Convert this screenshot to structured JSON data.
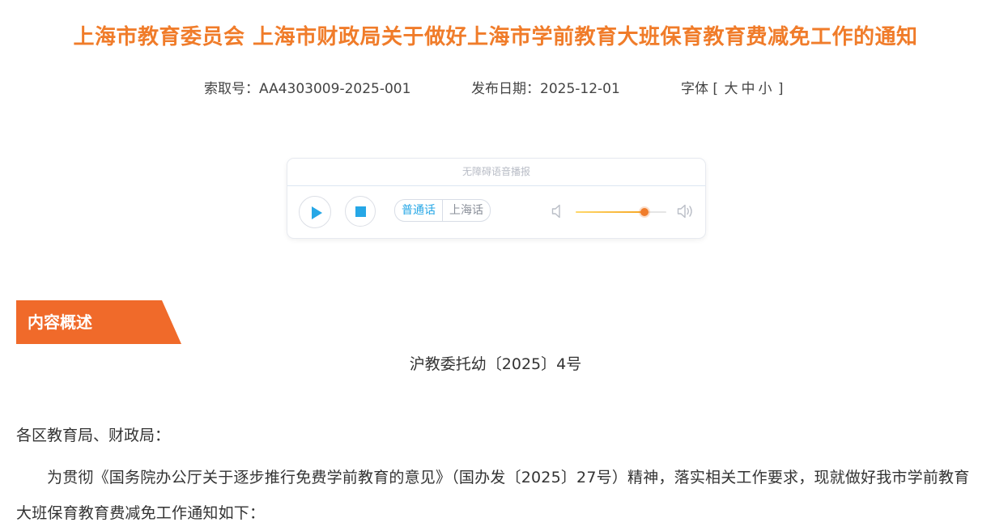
{
  "article": {
    "title": "上海市教育委员会 上海市财政局关于做好上海市学前教育大班保育教育费减免工作的通知",
    "meta": {
      "index_label": "索取号：",
      "index_value": "AA4303009-2025-001",
      "date_label": "发布日期：",
      "date_value": "2025-12-01",
      "font_label": "字体 [",
      "font_large": "大",
      "font_medium": "中",
      "font_small": "小",
      "font_close": "]"
    }
  },
  "player": {
    "caption": "无障碍语音播报",
    "play_icon": "play-icon",
    "stop_icon": "stop-icon",
    "dialects": [
      "普通话",
      "上海话"
    ],
    "selected_dialect": "普通话",
    "volume": 0.76,
    "volume_low_icon": "speaker-low-icon",
    "volume_high_icon": "speaker-high-icon",
    "accent_color": "#26a7e6"
  },
  "section": {
    "label": "内容概述",
    "color": "#f06a2a"
  },
  "content": {
    "doc_number": "沪教委托幼〔2025〕4号",
    "addressee": "各区教育局、财政局：",
    "paragraph1": "为贯彻《国务院办公厅关于逐步推行免费学前教育的意见》（国办发〔2025〕27号）精神，落实相关工作要求，现就做好我市学前教育大班保育教育费减免工作通知如下："
  },
  "colors": {
    "title": "#f07c2a",
    "text": "#333333"
  }
}
